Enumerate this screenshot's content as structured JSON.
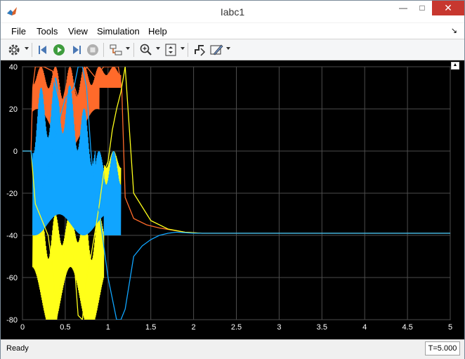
{
  "window": {
    "title": "Iabc1",
    "minimize_glyph": "—",
    "maximize_glyph": "□",
    "close_glyph": "✕"
  },
  "menu": {
    "items": [
      "File",
      "Tools",
      "View",
      "Simulation",
      "Help"
    ],
    "dock_glyph": "↘"
  },
  "toolbar": {
    "icons": [
      "gear-icon",
      "step-back-icon",
      "run-icon",
      "step-forward-icon",
      "stop-icon",
      "signal-select-icon",
      "zoom-icon",
      "scale-axes-icon",
      "highlight-block-icon",
      "style-icon"
    ]
  },
  "status": {
    "text": "Ready",
    "time": "T=5.000"
  },
  "colors": {
    "background": "#000000",
    "grid": "#4d4d4d",
    "axis_text": "#ffffff",
    "series_a": "#ff6a2a",
    "series_b": "#ffff19",
    "series_c": "#10a5ff"
  },
  "chart_data": {
    "type": "line",
    "title": "",
    "xlabel": "",
    "ylabel": "",
    "xlim": [
      0,
      5
    ],
    "ylim": [
      -80,
      40
    ],
    "grid": true,
    "legend": false,
    "xticks": [
      "0",
      "0.5",
      "1",
      "1.5",
      "2",
      "2.5",
      "3",
      "3.5",
      "4",
      "4.5",
      "5"
    ],
    "xtick_values": [
      0,
      0.5,
      1,
      1.5,
      2,
      2.5,
      3,
      3.5,
      4,
      4.5,
      5
    ],
    "yticks": [
      "40",
      "20",
      "0",
      "-20",
      "-40",
      "-60",
      "-80"
    ],
    "ytick_values": [
      40,
      20,
      0,
      -20,
      -40,
      -60,
      -80
    ],
    "series": [
      {
        "color": "#ff6a2a",
        "x": [
          0,
          0.1,
          0.12,
          0.15,
          0.25,
          0.35,
          0.45,
          0.55,
          0.65,
          0.75,
          0.85,
          0.95,
          1.0,
          1.05,
          1.12,
          1.16,
          1.2,
          1.3,
          1.45,
          1.6,
          1.75,
          1.9,
          2.1,
          2.5,
          5
        ],
        "y": [
          0,
          0,
          30,
          40,
          40,
          38,
          20,
          38,
          25,
          40,
          35,
          40,
          40,
          40,
          40,
          30,
          -22,
          -32,
          -35,
          -36.5,
          -37.5,
          -38.5,
          -39,
          -39,
          -39
        ]
      },
      {
        "color": "#ffff19",
        "x": [
          0,
          0.1,
          0.15,
          0.2,
          0.3,
          0.35,
          0.4,
          0.45,
          0.5,
          0.55,
          0.6,
          0.65,
          0.7,
          0.75,
          0.8,
          0.85,
          0.9,
          0.95,
          1.0,
          1.05,
          1.1,
          1.15,
          1.2,
          1.3,
          1.5,
          1.7,
          1.9,
          2.1,
          5
        ],
        "y": [
          0,
          0,
          -25,
          -30,
          -40,
          -55,
          -80,
          -60,
          -42,
          -48,
          -50,
          -78,
          -80,
          -60,
          -50,
          -38,
          -25,
          -10,
          -5,
          10,
          20,
          28,
          40,
          -20,
          -33,
          -37,
          -38.5,
          -39,
          -39
        ]
      },
      {
        "color": "#10a5ff",
        "x": [
          0,
          0.1,
          0.15,
          0.2,
          0.3,
          0.4,
          0.5,
          0.6,
          0.65,
          0.7,
          0.75,
          0.8,
          0.85,
          0.9,
          0.95,
          1.0,
          1.05,
          1.1,
          1.15,
          1.2,
          1.3,
          1.4,
          1.5,
          1.6,
          1.7,
          1.8,
          2.0,
          5
        ],
        "y": [
          0,
          0,
          -15,
          -20,
          -10,
          10,
          25,
          30,
          40,
          40,
          30,
          0,
          -20,
          -30,
          -45,
          -60,
          -70,
          -80,
          -80,
          -75,
          -50,
          -45,
          -42,
          -40,
          -39,
          -38.5,
          -39,
          -39
        ]
      }
    ]
  }
}
